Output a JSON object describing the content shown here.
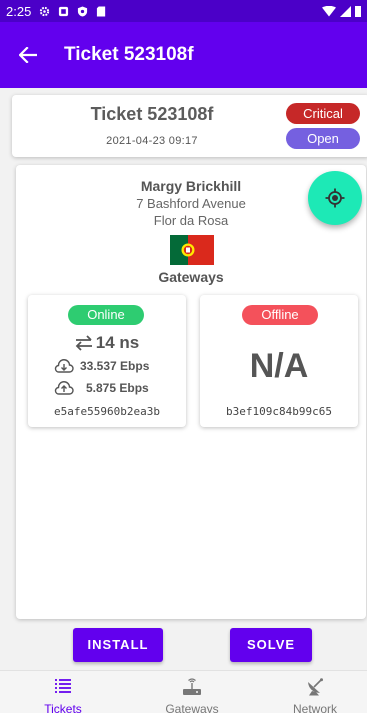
{
  "status_bar": {
    "time": "2:25"
  },
  "app_bar": {
    "title": "Ticket 523108f"
  },
  "ticket": {
    "title": "Ticket 523108f",
    "date": "2021-04-23 09:17",
    "severity": "Critical",
    "state": "Open"
  },
  "customer": {
    "name": "Margy Brickhill",
    "address_line1": "7 Bashford Avenue",
    "address_line2": "Flor da Rosa",
    "flag": "portugal-flag"
  },
  "gateways_heading": "Gateways",
  "gateways": [
    {
      "status": "Online",
      "latency": "14 ns",
      "download": "33.537 Ebps",
      "upload": "5.875 Ebps",
      "id": "e5afe55960b2ea3b"
    },
    {
      "status": "Offline",
      "value": "N/A",
      "id": "b3ef109c84b99c65"
    }
  ],
  "actions": {
    "install": "INSTALL",
    "solve": "SOLVE"
  },
  "bottom_nav": [
    {
      "label": "Tickets",
      "icon": "tickets-list-icon",
      "active": true
    },
    {
      "label": "Gateways",
      "icon": "router-icon",
      "active": false
    },
    {
      "label": "Network",
      "icon": "satellite-dish-icon",
      "active": false
    }
  ],
  "colors": {
    "primary": "#6200ee",
    "status_bar": "#4b00c8",
    "critical": "#c62828",
    "open": "#7560e0",
    "online": "#2ecc71",
    "offline": "#f4515b",
    "fab": "#1de9b6"
  }
}
